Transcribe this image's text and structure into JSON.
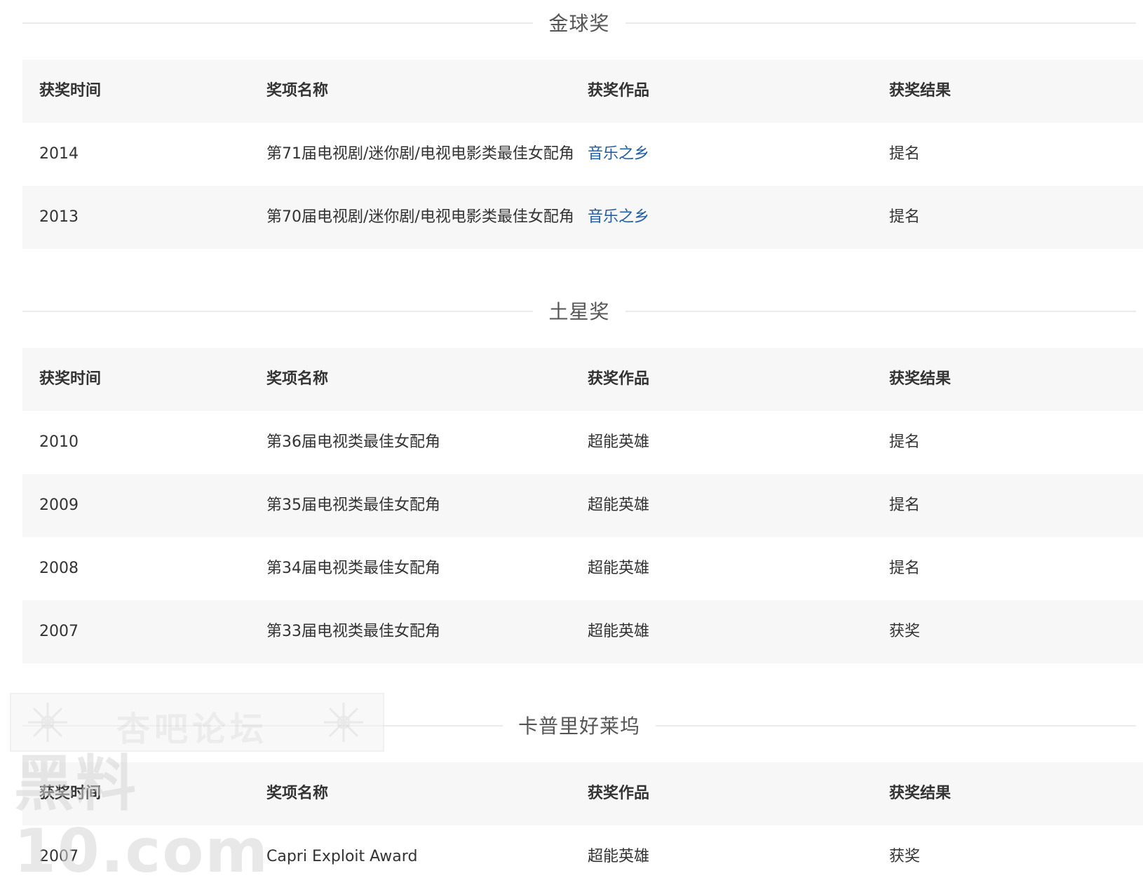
{
  "columns": [
    "获奖时间",
    "奖项名称",
    "获奖作品",
    "获奖结果"
  ],
  "sections": [
    {
      "title": "金球奖",
      "rows": [
        {
          "year": "2014",
          "award": "第71届电视剧/迷你剧/电视电影类最佳女配角",
          "work": "音乐之乡",
          "work_is_link": true,
          "result": "提名"
        },
        {
          "year": "2013",
          "award": "第70届电视剧/迷你剧/电视电影类最佳女配角",
          "work": "音乐之乡",
          "work_is_link": true,
          "result": "提名"
        }
      ]
    },
    {
      "title": "土星奖",
      "rows": [
        {
          "year": "2010",
          "award": "第36届电视类最佳女配角",
          "work": "超能英雄",
          "work_is_link": false,
          "result": "提名"
        },
        {
          "year": "2009",
          "award": "第35届电视类最佳女配角",
          "work": "超能英雄",
          "work_is_link": false,
          "result": "提名"
        },
        {
          "year": "2008",
          "award": "第34届电视类最佳女配角",
          "work": "超能英雄",
          "work_is_link": false,
          "result": "提名"
        },
        {
          "year": "2007",
          "award": "第33届电视类最佳女配角",
          "work": "超能英雄",
          "work_is_link": false,
          "result": "获奖"
        }
      ]
    },
    {
      "title": "卡普里好莱坞",
      "rows": [
        {
          "year": "2007",
          "award": "Capri Exploit Award",
          "work": "超能英雄",
          "work_is_link": false,
          "result": "获奖"
        }
      ]
    }
  ],
  "watermark": {
    "forum_text": "杏吧论坛",
    "site_text": "黑料10.com"
  },
  "colors": {
    "link": "#1e5fa8",
    "header_bg": "#f7f7f7",
    "divider": "#ebebeb"
  }
}
